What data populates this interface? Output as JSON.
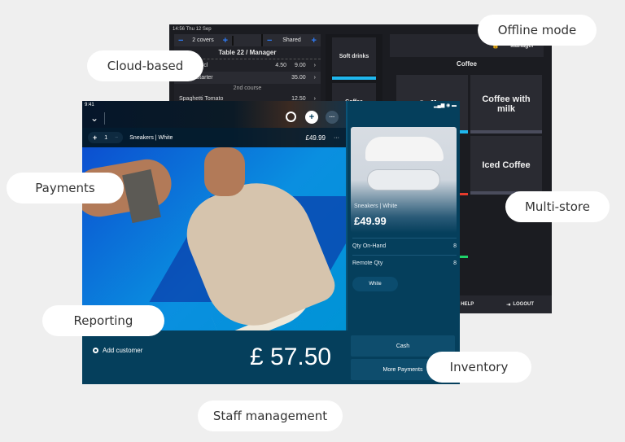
{
  "back_pos": {
    "status": "14:56  Thu 12 Sep",
    "covers_label": "2 covers",
    "shared_label": "Shared",
    "minus": "−",
    "plus": "+",
    "table_title": "Table 22 / Manager",
    "order_rows": [
      {
        "name": "Beer 0.33cl",
        "price": "4.50",
        "total": "9.00"
      },
      {
        "name": "Mixed Starter",
        "price": "",
        "total": "35.00"
      }
    ],
    "course_label": "2nd course",
    "course_rows": [
      {
        "name": "Spaghetti Tomato",
        "total": "12.50"
      }
    ],
    "categories": [
      {
        "label": "Soft drinks",
        "color": "#1fb7ee"
      },
      {
        "label": "Coffee",
        "color": "#d9a06b"
      }
    ],
    "user_label": "Manager",
    "section_title": "Coffee",
    "tiles": [
      "Coffee",
      "Coffee with milk",
      "Iced Coffee"
    ],
    "footer_help": "HELP",
    "footer_logout": "LOGOUT"
  },
  "front_pos": {
    "status_time": "9:41",
    "signal": "▂▄▆ ◉ ▬",
    "line_item": {
      "qty": "1",
      "name": "Sneakers | White",
      "price": "£49.99"
    },
    "product": {
      "name": "Sneakers | White",
      "price": "£49.99",
      "qty_on_hand_label": "Qty On-Hand",
      "qty_on_hand": "8",
      "remote_qty_label": "Remote Qty",
      "remote_qty": "8",
      "variant": "White"
    },
    "add_customer": "Add customer",
    "total": "£ 57.50",
    "cash_label": "Cash",
    "more_payments_label": "More Payments"
  },
  "features": [
    "Offline mode",
    "Cloud-based",
    "Payments",
    "Multi-store",
    "Reporting",
    "Inventory",
    "Staff management"
  ]
}
